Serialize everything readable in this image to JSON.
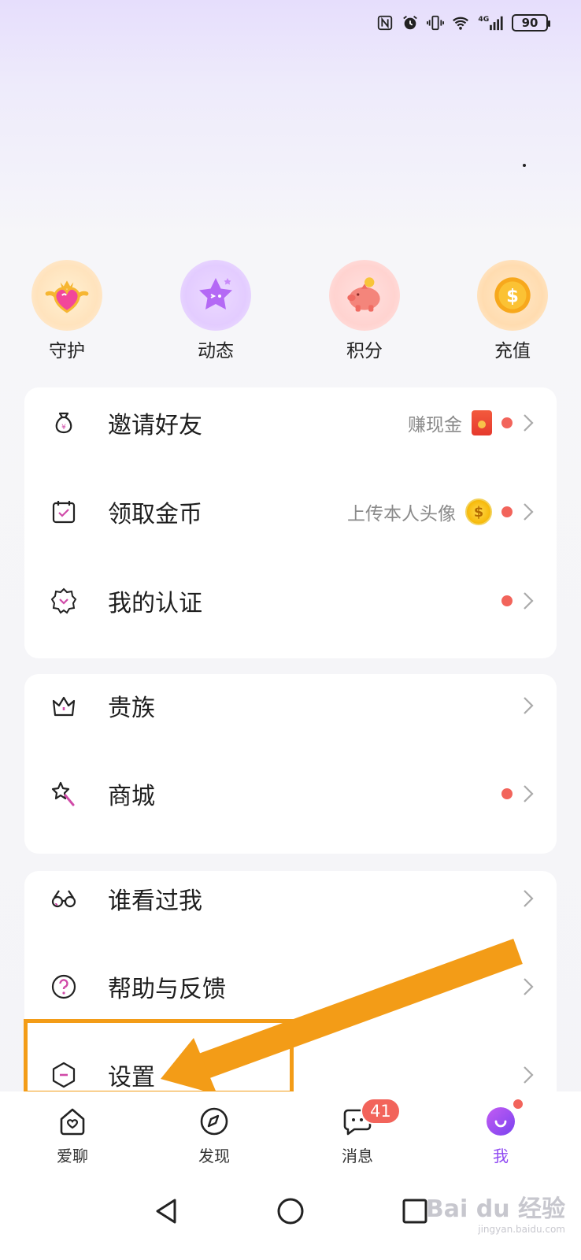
{
  "status_bar": {
    "battery": "90",
    "network": "4G"
  },
  "quick_entries": [
    {
      "label": "守护",
      "icon": "heart-crown-icon"
    },
    {
      "label": "动态",
      "icon": "star-face-icon"
    },
    {
      "label": "积分",
      "icon": "piggy-bank-icon"
    },
    {
      "label": "充值",
      "icon": "coin-dollar-icon"
    }
  ],
  "card1": {
    "rows": [
      {
        "title": "邀请好友",
        "hint": "赚现金",
        "icon": "money-bag-icon",
        "has_dot": true
      },
      {
        "title": "领取金币",
        "hint": "上传本人头像",
        "icon": "calendar-check-icon",
        "has_dot": true
      },
      {
        "title": "我的认证",
        "hint": "",
        "icon": "badge-heart-icon",
        "has_dot": true
      }
    ]
  },
  "card2": {
    "rows": [
      {
        "title": "贵族",
        "icon": "crown-icon",
        "has_dot": false
      },
      {
        "title": "商城",
        "icon": "magic-wand-star-icon",
        "has_dot": true
      }
    ]
  },
  "card3": {
    "rows": [
      {
        "title": "谁看过我",
        "icon": "glasses-icon"
      },
      {
        "title": "帮助与反馈",
        "icon": "question-circle-icon"
      },
      {
        "title": "设置",
        "icon": "hexagon-settings-icon"
      }
    ]
  },
  "bottom_nav": {
    "items": [
      {
        "label": "爱聊",
        "icon": "home-heart-icon"
      },
      {
        "label": "发现",
        "icon": "compass-icon"
      },
      {
        "label": "消息",
        "icon": "chat-bubble-icon",
        "badge": "41"
      },
      {
        "label": "我",
        "icon": "smile-profile-icon",
        "active": true
      }
    ]
  },
  "watermark": {
    "main": "Bai du 经验",
    "sub": "jingyan.baidu.com"
  },
  "colors": {
    "accent_purple": "#8f49f2",
    "red_dot": "#f2645b",
    "annotation_orange": "#f39c17"
  }
}
